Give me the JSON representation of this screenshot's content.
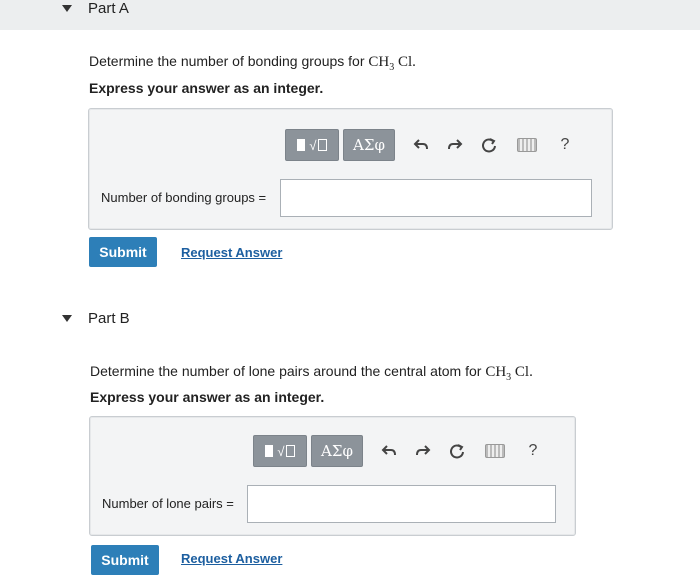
{
  "partA": {
    "title": "Part A",
    "question_prefix": "Determine the number of bonding groups for ",
    "formula_main": "CH",
    "formula_sub": "3",
    "formula_tail": "Cl.",
    "instruction": "Express your answer as an integer.",
    "field_label": "Number of bonding groups =",
    "field_value": "",
    "submit_label": "Submit",
    "request_label": "Request Answer"
  },
  "partB": {
    "title": "Part B",
    "question_prefix": "Determine the number of lone pairs around the central atom for ",
    "formula_main": "CH",
    "formula_sub": "3",
    "formula_tail": "Cl.",
    "instruction": "Express your answer as an integer.",
    "field_label": "Number of lone pairs =",
    "field_value": "",
    "submit_label": "Submit",
    "request_label": "Request Answer"
  },
  "toolbar": {
    "sqrt_glyph": "√",
    "greek_label": "ΑΣφ",
    "help_label": "?"
  },
  "colors": {
    "submit": "#2d7fb8",
    "toolbar_group": "#8c939a",
    "link": "#1d5fa0"
  }
}
